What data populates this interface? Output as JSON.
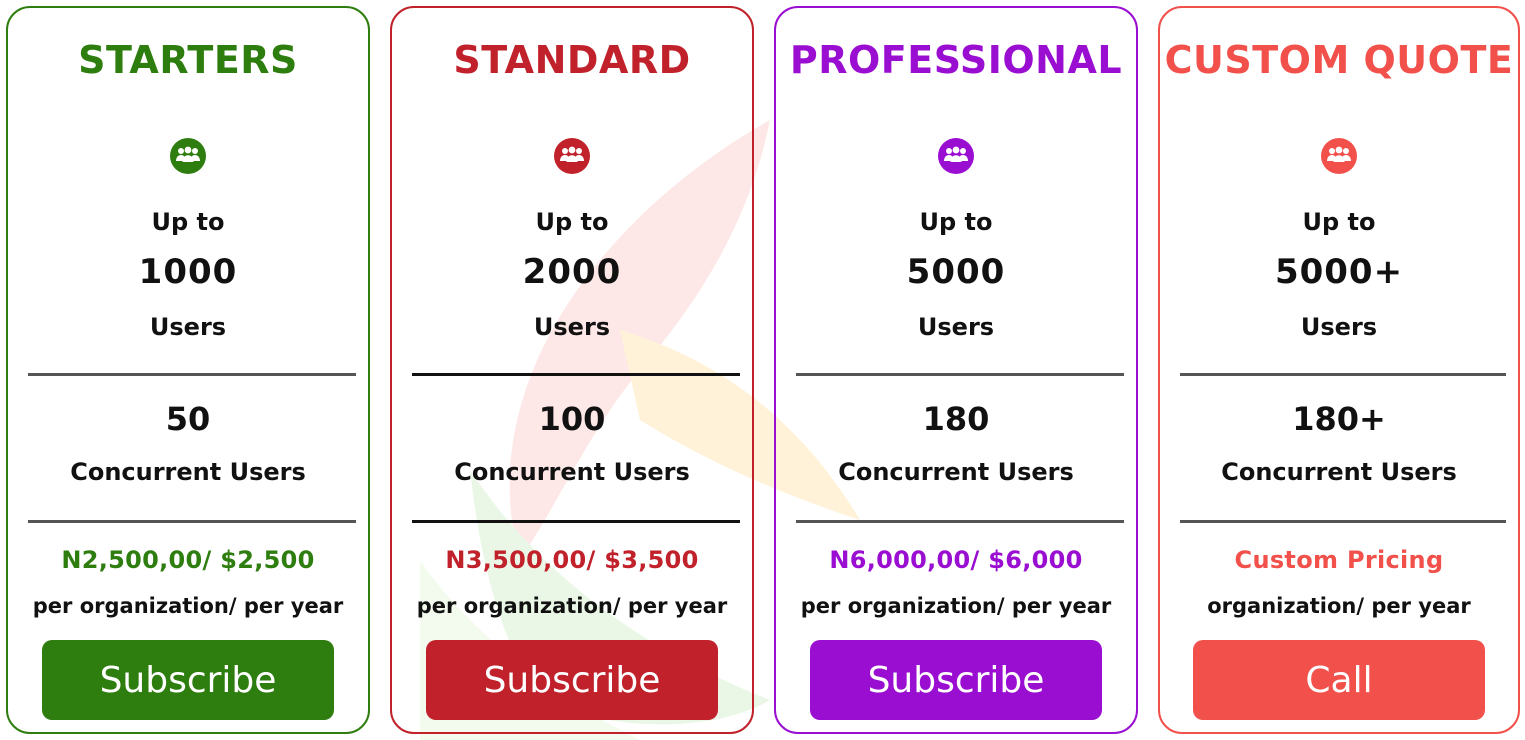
{
  "plans": [
    {
      "title": "STARTERS",
      "up_to": "Up to",
      "users_count": "1000",
      "users_label": "Users",
      "concurrent_count": "50",
      "concurrent_label": "Concurrent Users",
      "price": "N2,500,00/ $2,500",
      "period": "per organization/ per year",
      "button": "Subscribe",
      "accent_color": "#2e7d0f",
      "icon": "users-group-icon"
    },
    {
      "title": "STANDARD",
      "up_to": "Up to",
      "users_count": "2000",
      "users_label": "Users",
      "concurrent_count": "100",
      "concurrent_label": "Concurrent Users",
      "price": "N3,500,00/ $3,500",
      "period": "per organization/ per year",
      "button": "Subscribe",
      "accent_color": "#c0212a",
      "icon": "users-group-icon"
    },
    {
      "title": "PROFESSIONAL",
      "up_to": "Up to",
      "users_count": "5000",
      "users_label": "Users",
      "concurrent_count": "180",
      "concurrent_label": "Concurrent Users",
      "price": "N6,000,00/ $6,000",
      "period": "per organization/ per year",
      "button": "Subscribe",
      "accent_color": "#9a0ed1",
      "icon": "users-group-icon"
    },
    {
      "title": "CUSTOM QUOTE",
      "up_to": "Up to",
      "users_count": "5000+",
      "users_label": "Users",
      "concurrent_count": "180+",
      "concurrent_label": "Concurrent Users",
      "price": "Custom Pricing",
      "period": "organization/ per year",
      "button": "Call",
      "accent_color": "#f2504b",
      "icon": "users-group-icon"
    }
  ],
  "colors": {
    "text": "#111111",
    "divider": "#555555",
    "watermark_red": "#fde4e4",
    "watermark_yellow": "#fff4d6",
    "watermark_green": "#e8f7e6"
  }
}
